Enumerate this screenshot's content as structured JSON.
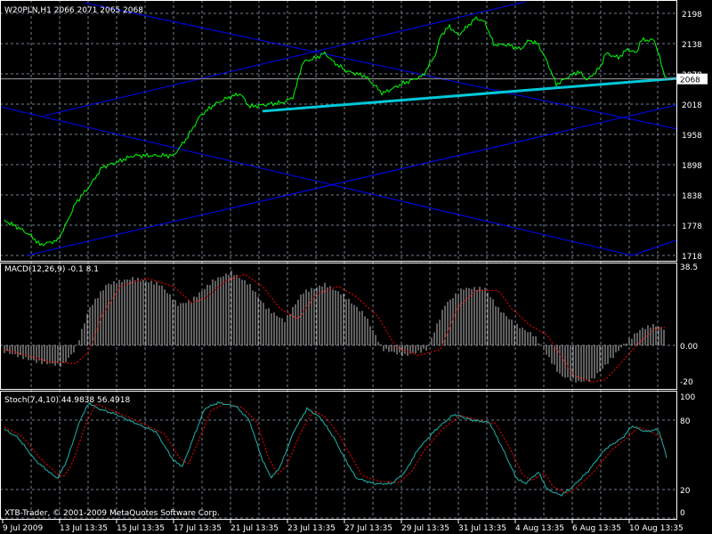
{
  "main_pane": {
    "title": "W20PLN,H1  2066 2071 2065 2068",
    "current_price_label": "2068",
    "price_ticks": [
      "2198",
      "2138",
      "2078",
      "2018",
      "1958",
      "1898",
      "1838",
      "1778",
      "1718"
    ],
    "colors": {
      "price": "#00ff00",
      "trendline": "#0000ff",
      "support": "#00c8d8",
      "grid": "#708090"
    }
  },
  "macd_pane": {
    "title": "MACD(12,26,9) -0.1 8.1",
    "ticks": [
      "38.5",
      "0.00",
      "-20"
    ]
  },
  "stoch_pane": {
    "title": "Stoch(7,4,10) 44.9838 56.4918",
    "ticks": [
      "100",
      "80",
      "20",
      "0"
    ]
  },
  "copyright": "XTB-Trader, © 2001-2009 MetaQuotes Software Corp.",
  "time_axis": [
    "9 Jul 2009",
    "13 Jul 13:35",
    "15 Jul 13:35",
    "17 Jul 13:35",
    "21 Jul 13:35",
    "23 Jul 13:35",
    "27 Jul 13:35",
    "29 Jul 13:35",
    "31 Jul 13:35",
    "4 Aug 13:35",
    "6 Aug 13:35",
    "10 Aug 13:35"
  ],
  "chart_data": [
    {
      "type": "line",
      "title": "W20PLN,H1",
      "ylim": [
        1718,
        2198
      ],
      "series": [
        {
          "name": "price",
          "points": [
            [
              5,
              1787
            ],
            [
              20,
              1774
            ],
            [
              35,
              1757
            ],
            [
              45,
              1739
            ],
            [
              65,
              1748
            ],
            [
              75,
              1783
            ],
            [
              85,
              1822
            ],
            [
              100,
              1854
            ],
            [
              115,
              1893
            ],
            [
              130,
              1902
            ],
            [
              150,
              1916
            ],
            [
              175,
              1916
            ],
            [
              195,
              1916
            ],
            [
              210,
              1951
            ],
            [
              225,
              1995
            ],
            [
              240,
              2016
            ],
            [
              255,
              2030
            ],
            [
              270,
              2039
            ],
            [
              280,
              2013
            ],
            [
              295,
              2016
            ],
            [
              320,
              2022
            ],
            [
              330,
              2034
            ],
            [
              340,
              2101
            ],
            [
              355,
              2110
            ],
            [
              365,
              2119
            ],
            [
              375,
              2101
            ],
            [
              390,
              2083
            ],
            [
              410,
              2074
            ],
            [
              430,
              2039
            ],
            [
              450,
              2057
            ],
            [
              475,
              2074
            ],
            [
              490,
              2119
            ],
            [
              495,
              2154
            ],
            [
              505,
              2172
            ],
            [
              515,
              2154
            ],
            [
              525,
              2172
            ],
            [
              535,
              2189
            ],
            [
              545,
              2180
            ],
            [
              555,
              2136
            ],
            [
              570,
              2136
            ],
            [
              585,
              2127
            ],
            [
              595,
              2145
            ],
            [
              605,
              2136
            ],
            [
              615,
              2101
            ],
            [
              625,
              2057
            ],
            [
              640,
              2074
            ],
            [
              650,
              2083
            ],
            [
              660,
              2066
            ],
            [
              675,
              2092
            ],
            [
              680,
              2119
            ],
            [
              695,
              2110
            ],
            [
              705,
              2127
            ],
            [
              715,
              2119
            ],
            [
              720,
              2145
            ],
            [
              735,
              2145
            ],
            [
              740,
              2119
            ],
            [
              745,
              2083
            ],
            [
              750,
              2068
            ]
          ]
        }
      ],
      "trendlines": [
        {
          "name": "channel-a",
          "from": [
            95,
            2219
          ],
          "to": [
            760,
            1969
          ]
        },
        {
          "name": "channel-b",
          "from": [
            0,
            2013
          ],
          "to": [
            710,
            1718
          ]
        },
        {
          "name": "channel-c",
          "from": [
            710,
            1718
          ],
          "to": [
            760,
            1748
          ]
        },
        {
          "name": "channel-d",
          "from": [
            50,
            1995
          ],
          "to": [
            590,
            2221
          ]
        },
        {
          "name": "channel-e",
          "from": [
            30,
            1718
          ],
          "to": [
            760,
            2016
          ]
        },
        {
          "name": "support",
          "from": [
            295,
            2004
          ],
          "to": [
            760,
            2069
          ]
        }
      ],
      "current_price": 2068
    },
    {
      "type": "bar",
      "title": "MACD(12,26,9)",
      "ylim": [
        -20,
        38.5
      ],
      "macd": [
        [
          5,
          -3
        ],
        [
          40,
          -8
        ],
        [
          70,
          -10
        ],
        [
          85,
          -2
        ],
        [
          100,
          18
        ],
        [
          120,
          30
        ],
        [
          150,
          33
        ],
        [
          180,
          30
        ],
        [
          200,
          20
        ],
        [
          215,
          22
        ],
        [
          240,
          32
        ],
        [
          260,
          36
        ],
        [
          280,
          30
        ],
        [
          300,
          18
        ],
        [
          320,
          12
        ],
        [
          340,
          26
        ],
        [
          365,
          30
        ],
        [
          385,
          25
        ],
        [
          410,
          15
        ],
        [
          430,
          -2
        ],
        [
          455,
          -5
        ],
        [
          480,
          -2
        ],
        [
          500,
          20
        ],
        [
          520,
          28
        ],
        [
          545,
          28
        ],
        [
          560,
          18
        ],
        [
          580,
          10
        ],
        [
          600,
          5
        ],
        [
          615,
          -5
        ],
        [
          630,
          -15
        ],
        [
          650,
          -18
        ],
        [
          665,
          -17
        ],
        [
          680,
          -10
        ],
        [
          700,
          0
        ],
        [
          720,
          8
        ],
        [
          735,
          10
        ],
        [
          748,
          8
        ]
      ],
      "signal": [
        [
          5,
          -2
        ],
        [
          55,
          -8
        ],
        [
          85,
          -9
        ],
        [
          100,
          -3
        ],
        [
          115,
          15
        ],
        [
          135,
          29
        ],
        [
          165,
          33
        ],
        [
          195,
          29
        ],
        [
          215,
          21
        ],
        [
          230,
          23
        ],
        [
          255,
          32
        ],
        [
          275,
          35
        ],
        [
          295,
          29
        ],
        [
          315,
          18
        ],
        [
          335,
          13
        ],
        [
          355,
          25
        ],
        [
          380,
          29
        ],
        [
          400,
          24
        ],
        [
          425,
          14
        ],
        [
          445,
          -1
        ],
        [
          470,
          -5
        ],
        [
          495,
          -2
        ],
        [
          515,
          19
        ],
        [
          535,
          27
        ],
        [
          560,
          27
        ],
        [
          575,
          18
        ],
        [
          595,
          10
        ],
        [
          615,
          5
        ],
        [
          630,
          -5
        ],
        [
          645,
          -15
        ],
        [
          665,
          -18
        ],
        [
          680,
          -17
        ],
        [
          695,
          -10
        ],
        [
          715,
          0
        ],
        [
          735,
          8
        ],
        [
          748,
          9
        ]
      ]
    },
    {
      "type": "line",
      "title": "Stoch(7,4,10)",
      "ylim": [
        0,
        100
      ],
      "main": [
        [
          5,
          72
        ],
        [
          20,
          65
        ],
        [
          40,
          45
        ],
        [
          60,
          32
        ],
        [
          65,
          30
        ],
        [
          75,
          45
        ],
        [
          90,
          80
        ],
        [
          100,
          95
        ],
        [
          110,
          90
        ],
        [
          130,
          85
        ],
        [
          150,
          78
        ],
        [
          175,
          70
        ],
        [
          195,
          45
        ],
        [
          205,
          40
        ],
        [
          215,
          60
        ],
        [
          230,
          90
        ],
        [
          245,
          95
        ],
        [
          265,
          92
        ],
        [
          280,
          80
        ],
        [
          295,
          45
        ],
        [
          305,
          30
        ],
        [
          315,
          40
        ],
        [
          330,
          70
        ],
        [
          345,
          90
        ],
        [
          360,
          82
        ],
        [
          375,
          65
        ],
        [
          385,
          50
        ],
        [
          400,
          30
        ],
        [
          420,
          25
        ],
        [
          440,
          25
        ],
        [
          455,
          35
        ],
        [
          470,
          55
        ],
        [
          490,
          72
        ],
        [
          510,
          85
        ],
        [
          530,
          80
        ],
        [
          550,
          78
        ],
        [
          565,
          55
        ],
        [
          580,
          30
        ],
        [
          590,
          25
        ],
        [
          605,
          35
        ],
        [
          615,
          20
        ],
        [
          630,
          15
        ],
        [
          640,
          20
        ],
        [
          660,
          35
        ],
        [
          680,
          55
        ],
        [
          700,
          65
        ],
        [
          710,
          75
        ],
        [
          725,
          70
        ],
        [
          740,
          72
        ],
        [
          750,
          45
        ]
      ],
      "signal": [
        [
          5,
          74
        ],
        [
          25,
          66
        ],
        [
          45,
          47
        ],
        [
          65,
          33
        ],
        [
          72,
          31
        ],
        [
          82,
          44
        ],
        [
          97,
          78
        ],
        [
          108,
          94
        ],
        [
          120,
          90
        ],
        [
          140,
          84
        ],
        [
          160,
          77
        ],
        [
          185,
          68
        ],
        [
          202,
          47
        ],
        [
          212,
          42
        ],
        [
          222,
          60
        ],
        [
          237,
          88
        ],
        [
          252,
          94
        ],
        [
          272,
          91
        ],
        [
          288,
          79
        ],
        [
          302,
          47
        ],
        [
          312,
          33
        ],
        [
          322,
          40
        ],
        [
          337,
          68
        ],
        [
          352,
          88
        ],
        [
          367,
          82
        ],
        [
          382,
          66
        ],
        [
          392,
          52
        ],
        [
          407,
          32
        ],
        [
          427,
          27
        ],
        [
          447,
          26
        ],
        [
          462,
          35
        ],
        [
          477,
          54
        ],
        [
          497,
          72
        ],
        [
          517,
          84
        ],
        [
          537,
          80
        ],
        [
          557,
          77
        ],
        [
          572,
          57
        ],
        [
          587,
          33
        ],
        [
          597,
          28
        ],
        [
          612,
          34
        ],
        [
          622,
          22
        ],
        [
          637,
          17
        ],
        [
          647,
          21
        ],
        [
          667,
          35
        ],
        [
          687,
          54
        ],
        [
          707,
          66
        ],
        [
          717,
          74
        ],
        [
          732,
          70
        ],
        [
          745,
          63
        ]
      ]
    }
  ]
}
